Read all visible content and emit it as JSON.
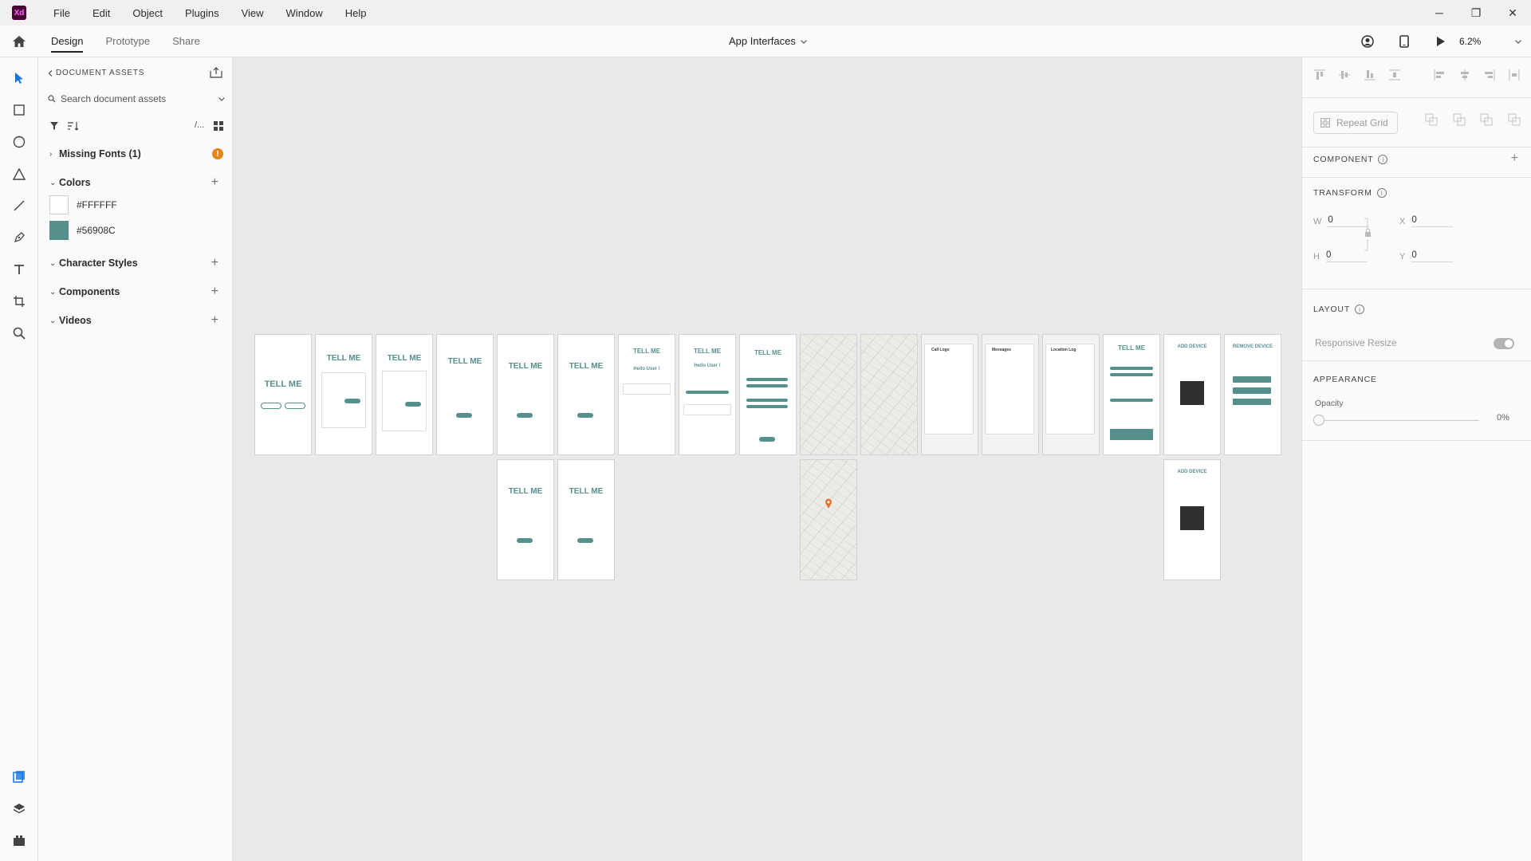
{
  "app": {
    "logo_text": "Xd"
  },
  "menu": [
    "File",
    "Edit",
    "Object",
    "Plugins",
    "View",
    "Window",
    "Help"
  ],
  "window_controls": {
    "minimize": "─",
    "restore": "❐",
    "close": "✕"
  },
  "mode_tabs": [
    "Design",
    "Prototype",
    "Share"
  ],
  "active_tab": "Design",
  "document_title": "App Interfaces",
  "zoom": "6.2%",
  "tools": [
    "select-icon",
    "rectangle-icon",
    "ellipse-icon",
    "polygon-icon",
    "line-icon",
    "pen-icon",
    "text-icon",
    "artboard-icon",
    "zoom-icon"
  ],
  "rail_bottom": [
    "document-assets-icon",
    "layers-icon",
    "plugins-icon"
  ],
  "assets": {
    "header": "DOCUMENT ASSETS",
    "search_placeholder": "Search document assets",
    "missing_fonts": "Missing Fonts (1)",
    "missing_badge": "!",
    "colors_title": "Colors",
    "colors": [
      {
        "hex": "#FFFFFF",
        "label": "#FFFFFF"
      },
      {
        "hex": "#56908C",
        "label": "#56908C"
      }
    ],
    "character_styles": "Character Styles",
    "components": "Components",
    "videos": "Videos",
    "filter_slash": "/..."
  },
  "artboards": {
    "logo": "TELL ME",
    "hello": "Hello User !",
    "add_device": "ADD DEVICE",
    "remove_device": "REMOVE DEVICE",
    "call_logs": "Call Logs",
    "messages": "Messages",
    "location_log": "Location Log",
    "brand_color": "#56908C",
    "accent_color": "#E8A020"
  },
  "properties": {
    "repeat_grid": "Repeat Grid",
    "component_title": "COMPONENT",
    "transform_title": "TRANSFORM",
    "w_label": "W",
    "w_value": "0",
    "h_label": "H",
    "h_value": "0",
    "x_label": "X",
    "x_value": "0",
    "y_label": "Y",
    "y_value": "0",
    "layout_title": "LAYOUT",
    "responsive_resize": "Responsive Resize",
    "appearance_title": "APPEARANCE",
    "opacity_label": "Opacity",
    "opacity_value": "0%",
    "info_glyph": "i",
    "add_glyph": "+"
  }
}
